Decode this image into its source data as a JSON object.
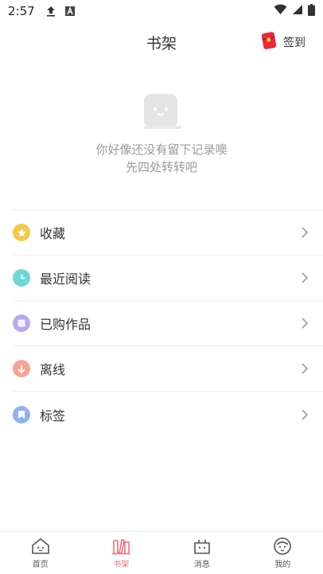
{
  "status_bar": {
    "time": "2:57"
  },
  "header": {
    "title": "书架",
    "signin_label": "签到"
  },
  "empty_state": {
    "line1": "你好像还没有留下记录噢",
    "line2": "先四处转转吧"
  },
  "menu": {
    "items": [
      {
        "label": "收藏",
        "icon": "star-icon",
        "color": "#f5c84c"
      },
      {
        "label": "最近阅读",
        "icon": "clock-icon",
        "color": "#6ed7d7"
      },
      {
        "label": "已购作品",
        "icon": "purchased-icon",
        "color": "#b8a8f3"
      },
      {
        "label": "离线",
        "icon": "download-icon",
        "color": "#f6a393"
      },
      {
        "label": "标签",
        "icon": "bookmark-icon",
        "color": "#8fb0f3"
      }
    ]
  },
  "tabbar": {
    "active": "书架",
    "accent": "#f06f7a",
    "tabs": [
      {
        "label": "首页",
        "icon": "home-icon"
      },
      {
        "label": "书架",
        "icon": "bookshelf-icon"
      },
      {
        "label": "消息",
        "icon": "message-icon"
      },
      {
        "label": "我的",
        "icon": "profile-icon"
      }
    ]
  }
}
